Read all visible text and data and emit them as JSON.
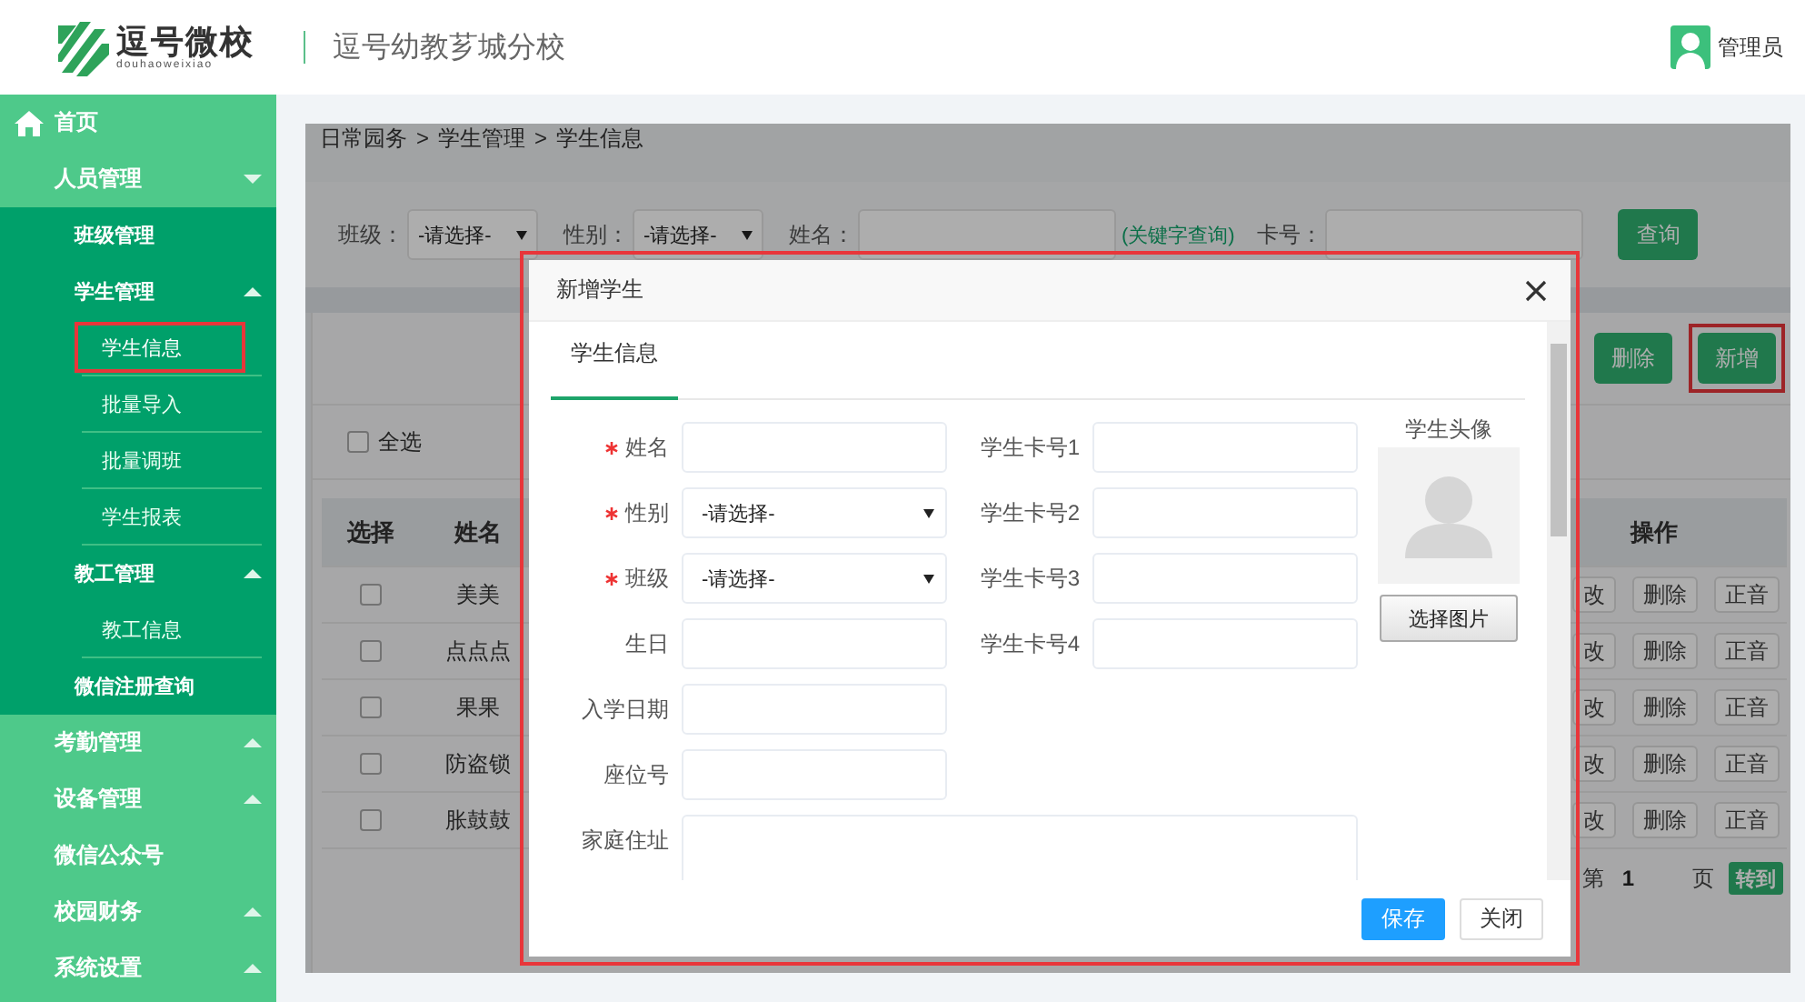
{
  "header": {
    "logo_name": "逗号微校",
    "logo_sub": "douhaoweixiao",
    "school": "逗号幼教芗城分校",
    "user": "管理员"
  },
  "sidebar": [
    {
      "label": "首页",
      "kind": "home"
    },
    {
      "label": "人员管理",
      "kind": "down",
      "children": [
        {
          "label": "班级管理",
          "kind": "plain"
        },
        {
          "label": "学生管理",
          "kind": "up",
          "children": [
            {
              "label": "学生信息",
              "selected": true,
              "marked": true
            },
            {
              "label": "批量导入",
              "selected": false,
              "marked": false
            },
            {
              "label": "批量调班",
              "selected": false,
              "marked": false
            },
            {
              "label": "学生报表",
              "selected": false,
              "marked": false
            }
          ]
        },
        {
          "label": "教工管理",
          "kind": "up",
          "children": [
            {
              "label": "教工信息",
              "selected": false,
              "marked": false
            }
          ]
        },
        {
          "label": "微信注册查询",
          "kind": "plain"
        }
      ]
    },
    {
      "label": "考勤管理",
      "kind": "up"
    },
    {
      "label": "设备管理",
      "kind": "up"
    },
    {
      "label": "微信公众号",
      "kind": "plain"
    },
    {
      "label": "校园财务",
      "kind": "up"
    },
    {
      "label": "系统设置",
      "kind": "up"
    }
  ],
  "breadcrumb": {
    "separator": ">",
    "items": [
      "日常园务",
      "学生管理",
      "学生信息"
    ]
  },
  "filters": [
    {
      "label": "班级：",
      "kind": "select",
      "value": "-请选择-"
    },
    {
      "label": "性别：",
      "kind": "select",
      "value": "-请选择-"
    },
    {
      "label": "姓名：",
      "kind": "text",
      "hint": "(关键字查询)"
    },
    {
      "label": "卡号：",
      "kind": "text"
    }
  ],
  "search_button": "查询",
  "toolbar": [
    {
      "label": "删除",
      "marked": false
    },
    {
      "label": "新增",
      "marked": true
    }
  ],
  "select_all": {
    "label": "全选",
    "checked": false
  },
  "table": {
    "columns": [
      "选择",
      "姓名",
      "操作"
    ],
    "rows": [
      {
        "checked": false,
        "name": "美美",
        "actions": [
          "改",
          "删除",
          "正音"
        ]
      },
      {
        "checked": false,
        "name": "点点点",
        "actions": [
          "改",
          "删除",
          "正音"
        ]
      },
      {
        "checked": false,
        "name": "果果",
        "actions": [
          "改",
          "删除",
          "正音"
        ]
      },
      {
        "checked": false,
        "name": "防盗锁",
        "actions": [
          "改",
          "删除",
          "正音"
        ]
      },
      {
        "checked": false,
        "name": "胀鼓鼓",
        "actions": [
          "改",
          "删除",
          "正音"
        ]
      }
    ]
  },
  "pagination": {
    "prefix": "第",
    "page": "1",
    "suffix": "页",
    "go": "转到"
  },
  "modal": {
    "title": "新增学生",
    "marked": true,
    "tabs": [
      {
        "label": "学生信息",
        "selected": true
      }
    ],
    "left_fields": [
      {
        "label": "姓名",
        "required": true,
        "kind": "text"
      },
      {
        "label": "性别",
        "required": true,
        "kind": "select",
        "value": "-请选择-"
      },
      {
        "label": "班级",
        "required": true,
        "kind": "select",
        "value": "-请选择-"
      },
      {
        "label": "生日",
        "required": false,
        "kind": "text"
      },
      {
        "label": "入学日期",
        "required": false,
        "kind": "text"
      },
      {
        "label": "座位号",
        "required": false,
        "kind": "text"
      },
      {
        "label": "家庭住址",
        "required": false,
        "kind": "textarea"
      }
    ],
    "right_fields": [
      {
        "label": "学生卡号1",
        "kind": "text"
      },
      {
        "label": "学生卡号2",
        "kind": "text"
      },
      {
        "label": "学生卡号3",
        "kind": "text"
      },
      {
        "label": "学生卡号4",
        "kind": "text"
      }
    ],
    "avatar": {
      "title": "学生头像",
      "button": "选择图片"
    },
    "buttons": [
      {
        "label": "保存",
        "kind": "primary"
      },
      {
        "label": "关闭",
        "kind": "default"
      }
    ]
  }
}
